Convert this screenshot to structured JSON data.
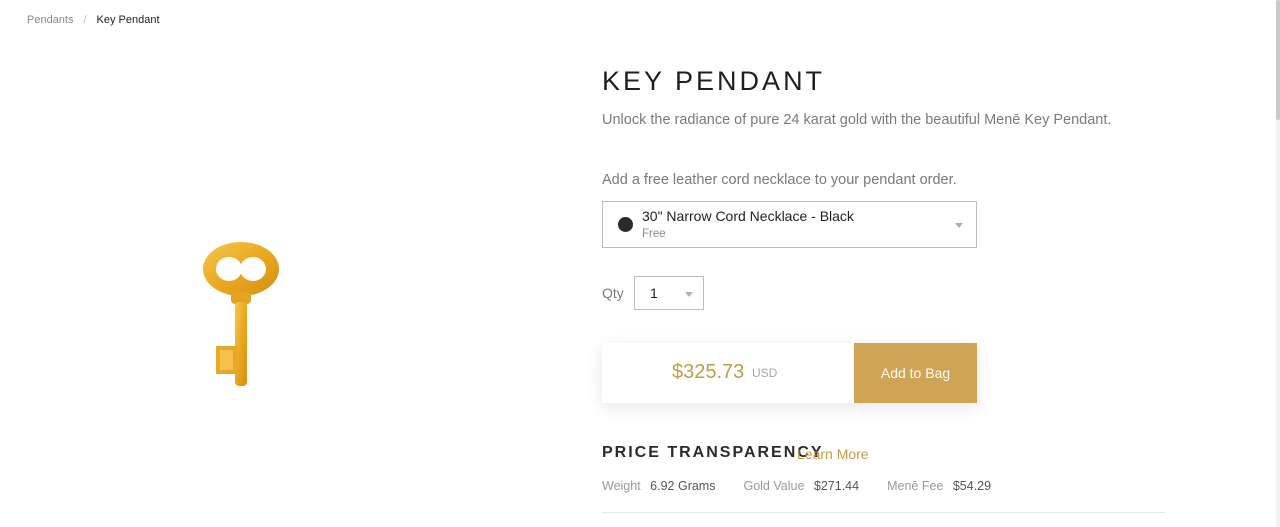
{
  "breadcrumb": {
    "parent": "Pendants",
    "separator": "/",
    "current": "Key Pendant"
  },
  "product": {
    "title": "KEY PENDANT",
    "description": "Unlock the radiance of pure 24 karat gold with the beautiful Menē Key Pendant.",
    "image_icon": "gold-key-image",
    "color_gold": "#d0a455"
  },
  "cord": {
    "prompt": "Add a free leather cord necklace to your pendant order.",
    "selected_name": "30\" Narrow Cord Necklace - Black",
    "selected_price": "Free",
    "swatch_color": "#2b2b2b"
  },
  "qty": {
    "label": "Qty",
    "value": "1"
  },
  "purchase": {
    "price": "$325.73",
    "currency": "USD",
    "button_label": "Add to Bag"
  },
  "price_transparency": {
    "title": "PRICE TRANSPARENCY",
    "learn_more": "Learn More",
    "specs": [
      {
        "label": "Weight",
        "value": "6.92 Grams"
      },
      {
        "label": "Gold Value",
        "value": "$271.44"
      },
      {
        "label": "Menē Fee",
        "value": "$54.29"
      }
    ]
  }
}
